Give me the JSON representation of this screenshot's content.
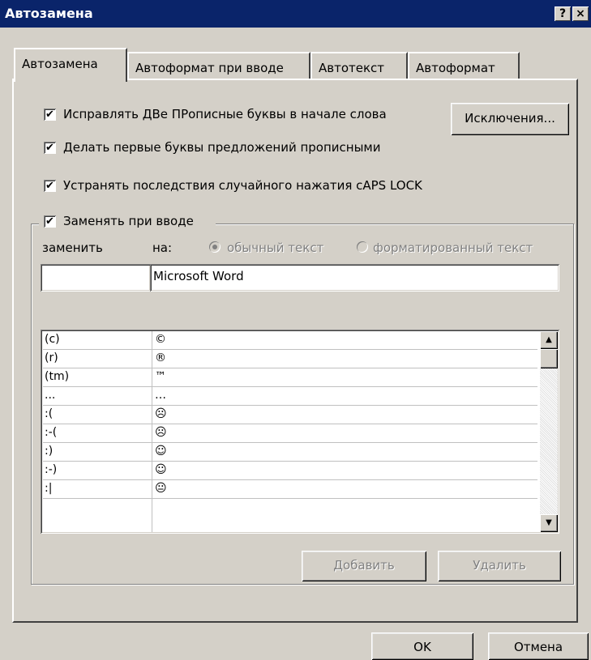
{
  "window": {
    "title": "Автозамена",
    "help_glyph": "?",
    "close_glyph": "×"
  },
  "tabs": [
    {
      "label": "Автозамена",
      "active": true
    },
    {
      "label": "Автоформат при вводе",
      "active": false
    },
    {
      "label": "Автотекст",
      "active": false
    },
    {
      "label": "Автоформат",
      "active": false
    }
  ],
  "options": {
    "two_caps": {
      "checked": true,
      "label": "Исправлять ДВе ПРописные буквы в начале слова"
    },
    "sentence_caps": {
      "checked": true,
      "label": "Делать первые буквы предложений прописными"
    },
    "caps_lock": {
      "checked": true,
      "label": "Устранять последствия случайного нажатия cAPS LOCK"
    },
    "replace_typing": {
      "checked": true,
      "label": "Заменять при вводе"
    }
  },
  "exceptions_button": "Исключения...",
  "replace": {
    "replace_label": "заменить",
    "with_label": "на:",
    "plain_text_label": "обычный текст",
    "formatted_text_label": "форматированный текст",
    "replace_value": "",
    "with_value": "Microsoft Word"
  },
  "list": {
    "rows": [
      {
        "from": "(c)",
        "to": "©"
      },
      {
        "from": "(r)",
        "to": "®"
      },
      {
        "from": "(tm)",
        "to": "™"
      },
      {
        "from": "...",
        "to": "…"
      },
      {
        "from": ":(",
        "to": "☹"
      },
      {
        "from": ":-(",
        "to": "☹"
      },
      {
        "from": ":)",
        "to": "☺"
      },
      {
        "from": ":-)",
        "to": "☺"
      },
      {
        "from": ":|",
        "to": "😐"
      }
    ],
    "scroll_up": "▲",
    "scroll_down": "▼"
  },
  "buttons": {
    "add": "Добавить",
    "delete": "Удалить",
    "ok": "OK",
    "cancel": "Отмена"
  }
}
